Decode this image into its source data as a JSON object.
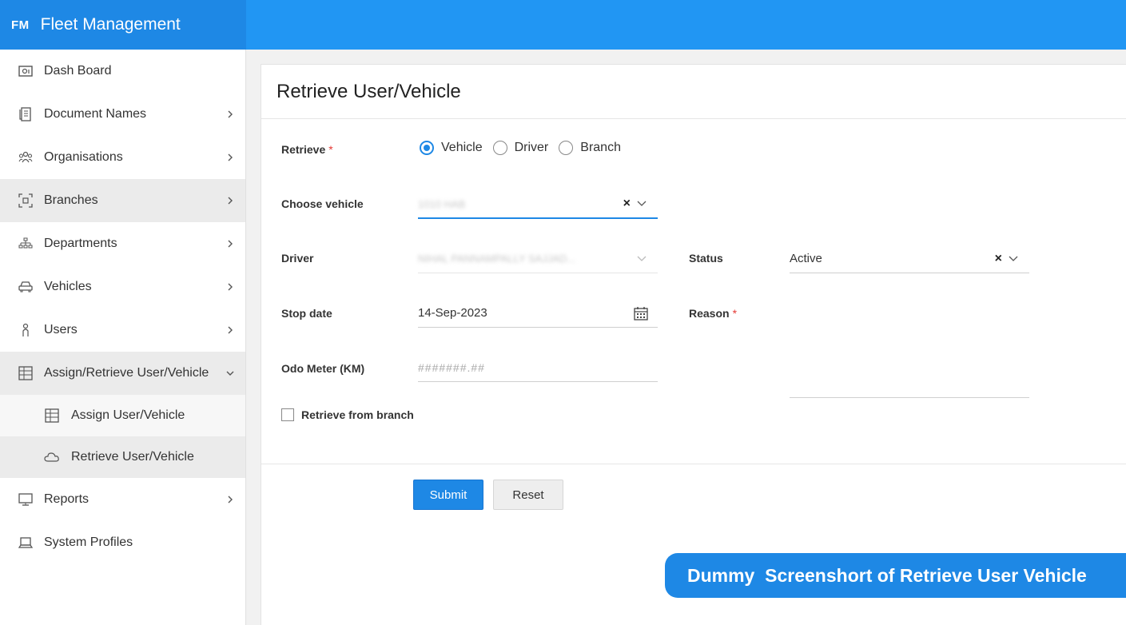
{
  "app": {
    "logo": "FM",
    "title": "Fleet Management"
  },
  "sidebar": {
    "items": [
      {
        "label": "Dash Board",
        "icon": "dashboard-icon",
        "chevron": false
      },
      {
        "label": "Document Names",
        "icon": "document-icon",
        "chevron": true
      },
      {
        "label": "Organisations",
        "icon": "organisations-icon",
        "chevron": true
      },
      {
        "label": "Branches",
        "icon": "branch-icon",
        "chevron": true,
        "active": true
      },
      {
        "label": "Departments",
        "icon": "hierarchy-icon",
        "chevron": true
      },
      {
        "label": "Vehicles",
        "icon": "car-icon",
        "chevron": true
      },
      {
        "label": "Users",
        "icon": "user-icon",
        "chevron": true
      },
      {
        "label": "Assign/Retrieve User/Vehicle",
        "icon": "grid-icon",
        "chevron": "down",
        "expanded": true
      },
      {
        "label": "Reports",
        "icon": "monitor-icon",
        "chevron": true
      },
      {
        "label": "System Profiles",
        "icon": "laptop-icon",
        "chevron": false
      }
    ],
    "subitems": [
      {
        "label": "Assign User/Vehicle",
        "icon": "grid-icon"
      },
      {
        "label": "Retrieve User/Vehicle",
        "icon": "cloud-icon",
        "selected": true
      }
    ]
  },
  "page": {
    "title": "Retrieve User/Vehicle"
  },
  "form": {
    "retrieve": {
      "label": "Retrieve",
      "required": "*",
      "options": [
        "Vehicle",
        "Driver",
        "Branch"
      ],
      "selected": "Vehicle"
    },
    "choose_vehicle": {
      "label": "Choose vehicle",
      "value": "1010 HAB"
    },
    "driver": {
      "label": "Driver",
      "value": "NIHAL PANNAMPALLY SAJJAD..."
    },
    "status": {
      "label": "Status",
      "value": "Active"
    },
    "stop_date": {
      "label": "Stop date",
      "value": "14-Sep-2023"
    },
    "reason": {
      "label": "Reason",
      "required": "*",
      "value": ""
    },
    "odo_meter": {
      "label": "Odo Meter (KM)",
      "placeholder": "#######.##"
    },
    "retrieve_from_branch": {
      "label": "Retrieve from branch",
      "checked": false
    }
  },
  "buttons": {
    "submit": "Submit",
    "reset": "Reset"
  },
  "banner": {
    "text": "Dummy  Screenshort of Retrieve User Vehicle"
  },
  "colors": {
    "primary": "#1e88e5",
    "header": "#2196f3",
    "required": "#e53935"
  }
}
